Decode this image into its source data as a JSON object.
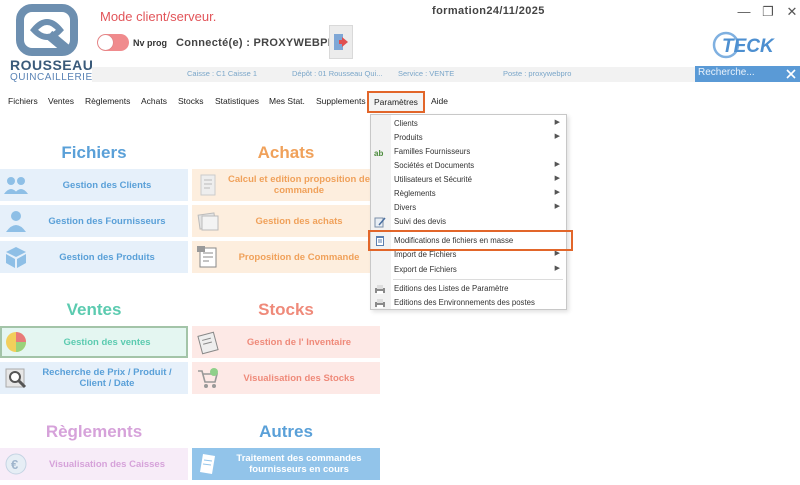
{
  "header": {
    "logo_name": "ROUSSEAU",
    "logo_sub": "QUINCAILLERIE",
    "mode": "Mode client/serveur.",
    "toggle_label": "Nv prog",
    "connected": "Connecté(e) :  PROXYWEBPRO",
    "window_title": "formation24/11/2025",
    "brand": "TECK"
  },
  "infobar": {
    "caisse": "Caisse : C1 Caisse 1",
    "depot": "Dépôt : 01 Rousseau Qui...",
    "service": "Service : VENTE",
    "poste": "Poste : proxywebpro",
    "search_placeholder": "Recherche..."
  },
  "menu": [
    "Fichiers",
    "Ventes",
    "Règlements",
    "Achats",
    "Stocks",
    "Statistiques",
    "Mes Stat.",
    "Supplements",
    "Paramètres",
    "Aide"
  ],
  "sections": {
    "fichiers": "Fichiers",
    "achats": "Achats",
    "ventes": "Ventes",
    "stocks": "Stocks",
    "reglements": "Règlements",
    "autres": "Autres"
  },
  "tiles": {
    "gestion_clients": "Gestion des Clients",
    "gestion_fournisseurs": "Gestion des Fournisseurs",
    "gestion_produits": "Gestion des Produits",
    "calcul_commande": "Calcul et edition proposition de commande",
    "gestion_achats": "Gestion des achats",
    "proposition_commande": "Proposition de Commande",
    "gestion_ventes": "Gestion des ventes",
    "recherche_prix": "Recherche de Prix / Produit / Client / Date",
    "gestion_inventaire": "Gestion de l' Inventaire",
    "visualisation_stocks": "Visualisation des Stocks",
    "visualisation_caisses": "Visualisation des Caisses",
    "traitement_commandes": "Traitement des commandes fournisseurs en cours"
  },
  "dropdown": {
    "items": [
      "Clients",
      "Produits",
      "Familles Fournisseurs",
      "Sociétés et Documents",
      "Utilisateurs et Sécurité",
      "Règlements",
      "Divers",
      "Suivi des devis",
      "Modifications de fichiers en masse",
      "Import de Fichiers",
      "Export de Fichiers",
      "Editions des Listes de Paramètre",
      "Editions des Environnements des postes"
    ]
  },
  "colors": {
    "accent_orange": "#e2662a",
    "search_blue": "#5a9ad6",
    "section_blue": "#5aa0d8",
    "section_orange": "#f0a15a",
    "section_green": "#5ccbb0",
    "section_red": "#ef8a7a",
    "section_purple": "#d6a2da"
  }
}
